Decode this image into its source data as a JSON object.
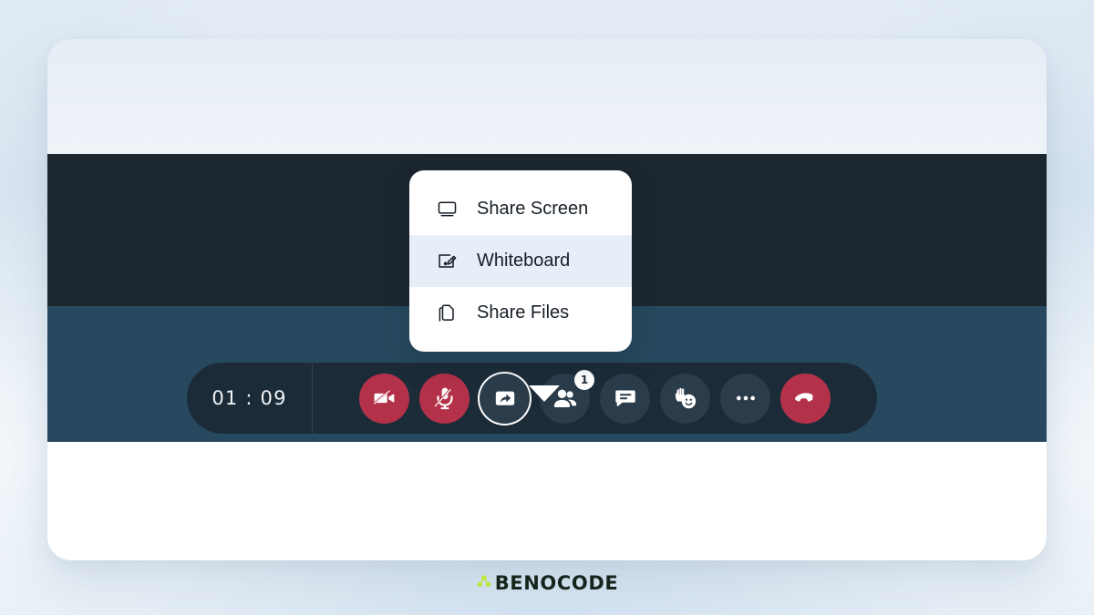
{
  "meta": {
    "screen_title": "Video call control bar with share menu open"
  },
  "colors": {
    "page_background_top": "#e3ecf5",
    "page_background_bottom": "#e9f1f8",
    "card_background": "#ffffff",
    "video_band": "#1c262f",
    "toolbar_band": "#27495f",
    "control_pill": "#1c2b38",
    "danger": "#b4314a",
    "neutral_button": "#2b3c4b",
    "menu_background": "#ffffff",
    "menu_selected_row": "#e8eef8",
    "menu_text": "#171f28",
    "brand_accent": "#c2e53a",
    "brand_text": "#16251c"
  },
  "call_controls": {
    "timer": "01 : 09",
    "buttons": [
      {
        "id": "camera",
        "name": "camera-toggle-button",
        "icon": "camera-off-icon",
        "style": "danger",
        "label": "Camera off"
      },
      {
        "id": "microphone",
        "name": "microphone-toggle-button",
        "icon": "microphone-off-icon",
        "style": "danger",
        "label": "Microphone off"
      },
      {
        "id": "share",
        "name": "share-screen-button",
        "icon": "share-icon",
        "style": "active",
        "label": "Share"
      },
      {
        "id": "participants",
        "name": "participants-button",
        "icon": "people-icon",
        "style": "neutral",
        "label": "Participants",
        "badge": "1"
      },
      {
        "id": "chat",
        "name": "chat-button",
        "icon": "chat-icon",
        "style": "neutral",
        "label": "Chat"
      },
      {
        "id": "reactions",
        "name": "reactions-button",
        "icon": "raise-hand-emoji-icon",
        "style": "neutral",
        "label": "Reactions"
      },
      {
        "id": "more",
        "name": "more-options-button",
        "icon": "ellipsis-icon",
        "style": "neutral",
        "label": "More options"
      },
      {
        "id": "endcall",
        "name": "end-call-button",
        "icon": "phone-hangup-icon",
        "style": "danger",
        "label": "End call"
      }
    ]
  },
  "share_menu": {
    "items": [
      {
        "label": "Share Screen",
        "icon": "monitor-icon",
        "selected": false
      },
      {
        "label": "Whiteboard",
        "icon": "whiteboard-icon",
        "selected": true
      },
      {
        "label": "Share Files",
        "icon": "files-icon",
        "selected": false
      }
    ]
  },
  "brand": {
    "text": "BENOCODE",
    "mark": "benocode-dots-mark"
  }
}
